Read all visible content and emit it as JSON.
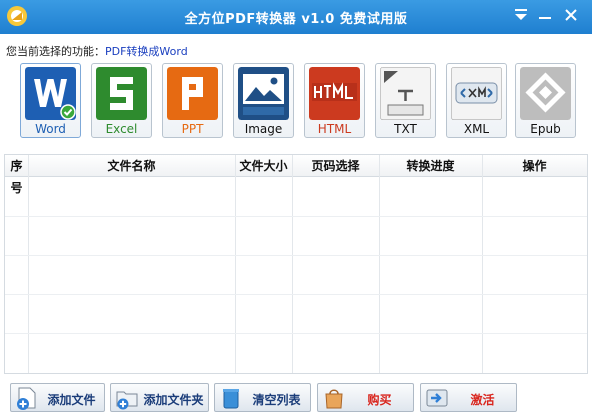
{
  "window": {
    "title": "全方位PDF转换器 v1.0 免费试用版"
  },
  "current_function": {
    "label": "您当前选择的功能：",
    "value": "PDF转换成Word"
  },
  "tools": [
    {
      "label": "Word",
      "color": "#1e5fb3"
    },
    {
      "label": "Excel",
      "color": "#2e8b2e"
    },
    {
      "label": "PPT",
      "color": "#e66a12"
    },
    {
      "label": "Image",
      "color": "#1f4f86"
    },
    {
      "label": "HTML",
      "color": "#cc3a1f"
    },
    {
      "label": "TXT",
      "color": "#f2f2f2"
    },
    {
      "label": "XML",
      "color": "#f2f2f2"
    },
    {
      "label": "Epub",
      "color": "#8a8a8a"
    }
  ],
  "table": {
    "columns": [
      "序号",
      "文件名称",
      "文件大小",
      "页码选择",
      "转换进度",
      "操作"
    ],
    "rows": []
  },
  "buttons": {
    "add_file": "添加文件",
    "add_folder": "添加文件夹",
    "clear_list": "清空列表",
    "buy": "购买",
    "activate": "激活"
  },
  "colors": {
    "titlebar": "#2a8ddb",
    "accent_text": "#1a3fbf",
    "buy_text": "#d9241c"
  }
}
